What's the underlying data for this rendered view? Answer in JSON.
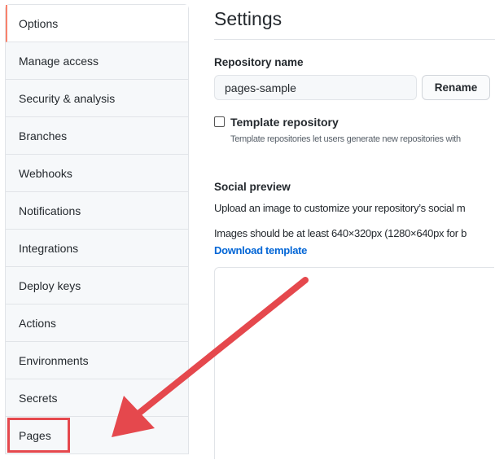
{
  "sidebar": {
    "items": [
      {
        "label": "Options"
      },
      {
        "label": "Manage access"
      },
      {
        "label": "Security & analysis"
      },
      {
        "label": "Branches"
      },
      {
        "label": "Webhooks"
      },
      {
        "label": "Notifications"
      },
      {
        "label": "Integrations"
      },
      {
        "label": "Deploy keys"
      },
      {
        "label": "Actions"
      },
      {
        "label": "Environments"
      },
      {
        "label": "Secrets"
      },
      {
        "label": "Pages"
      }
    ],
    "active": "Options",
    "highlighted": "Pages"
  },
  "main": {
    "title": "Settings",
    "repo_name_label": "Repository name",
    "repo_name_value": "pages-sample",
    "rename_label": "Rename",
    "template_label": "Template repository",
    "template_desc": "Template repositories let users generate new repositories with",
    "social_title": "Social preview",
    "social_desc": "Upload an image to customize your repository’s social m",
    "social_size": "Images should be at least 640×320px (1280×640px for b",
    "download_link": "Download template"
  },
  "colors": {
    "annotation": "#e5484d",
    "active_border": "#f9826c",
    "link": "#0366d6"
  }
}
